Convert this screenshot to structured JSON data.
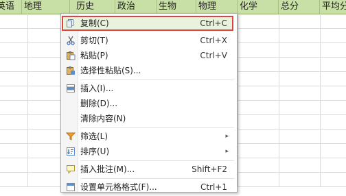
{
  "header": {
    "columns": [
      "英语",
      "地理",
      "历史",
      "政治",
      "生物",
      "物理",
      "化学",
      "总分",
      "平均分"
    ]
  },
  "menu": {
    "items": [
      {
        "label": "复制(C)",
        "shortcut": "Ctrl+C"
      },
      {
        "label": "剪切(T)",
        "shortcut": "Ctrl+X"
      },
      {
        "label": "粘贴(P)",
        "shortcut": "Ctrl+V"
      },
      {
        "label": "选择性粘贴(S)...",
        "shortcut": ""
      },
      {
        "label": "插入(I)...",
        "shortcut": ""
      },
      {
        "label": "删除(D)...",
        "shortcut": ""
      },
      {
        "label": "清除内容(N)",
        "shortcut": ""
      },
      {
        "label": "筛选(L)",
        "shortcut": ""
      },
      {
        "label": "排序(U)",
        "shortcut": ""
      },
      {
        "label": "插入批注(M)...",
        "shortcut": "Shift+F2"
      },
      {
        "label": "设置单元格格式(F)...",
        "shortcut": "Ctrl+1"
      }
    ],
    "highlight_color": "#d9463f"
  }
}
